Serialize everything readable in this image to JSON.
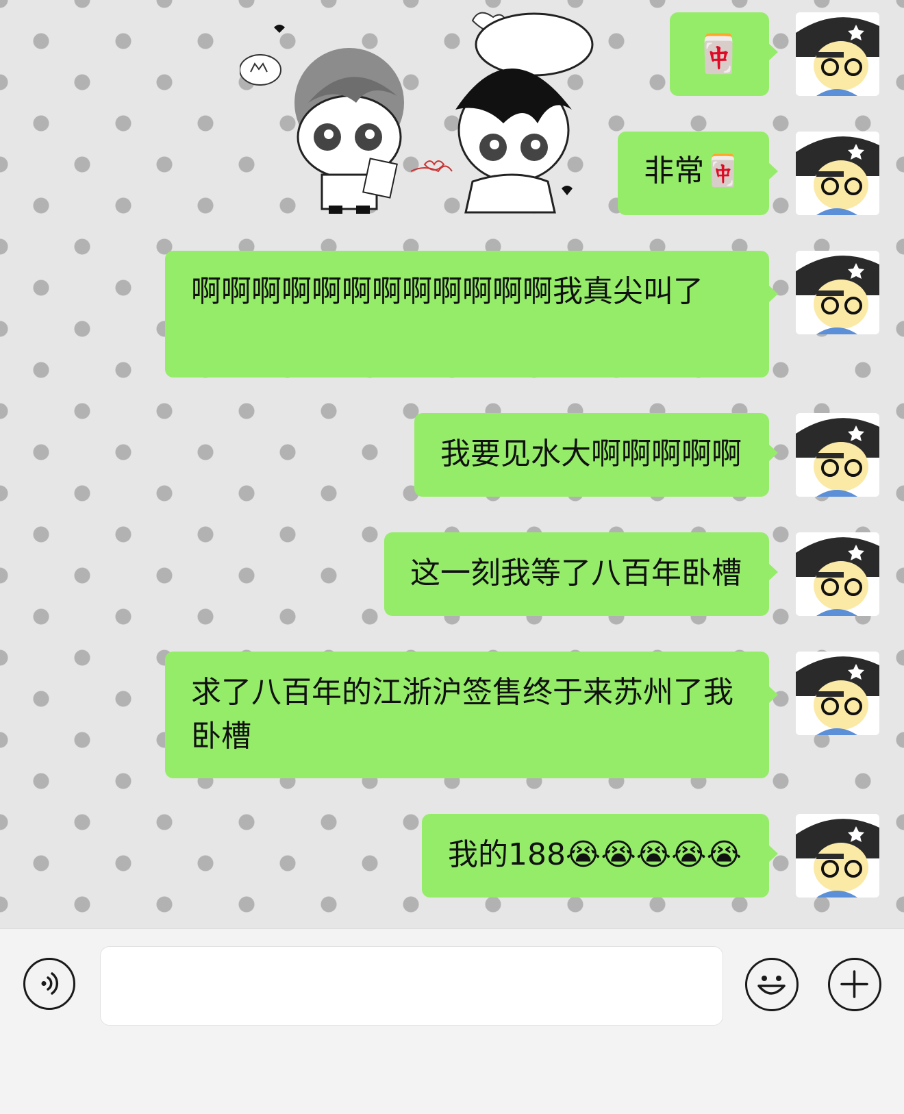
{
  "messages": [
    {
      "text": "🀄"
    },
    {
      "text": "非常🀄"
    },
    {
      "text": "啊啊啊啊啊啊啊啊啊啊啊啊我真尖叫了"
    },
    {
      "text": "我要见水大啊啊啊啊啊"
    },
    {
      "text": "这一刻我等了八百年卧槽"
    },
    {
      "text": "求了八百年的江浙沪签售终于来苏州了我卧槽"
    },
    {
      "text": "我的188😭😭😭😭😭"
    }
  ],
  "input": {
    "value": ""
  },
  "colors": {
    "bubble": "#95ec69",
    "background": "#e6e6e6",
    "hearts": "#a0a0a0"
  },
  "icons": {
    "voice": "voice-icon",
    "emoji": "emoji-icon",
    "plus": "plus-icon"
  }
}
